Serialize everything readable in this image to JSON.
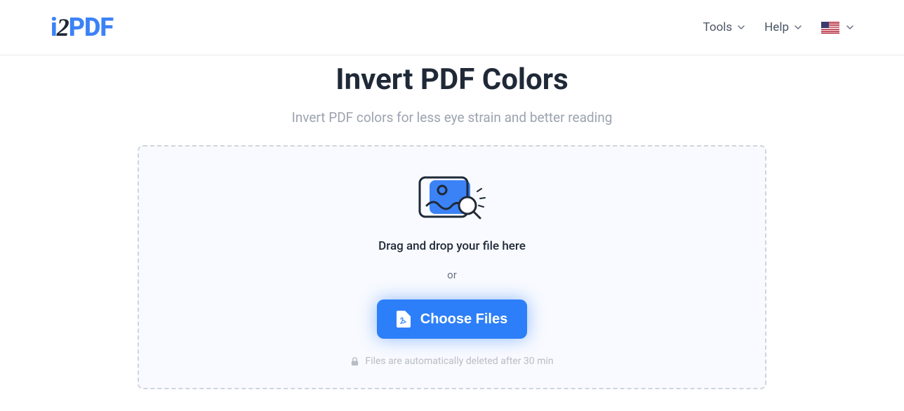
{
  "logo": {
    "part1": "i",
    "part2": "2",
    "part3": "PDF"
  },
  "nav": {
    "tools": "Tools",
    "help": "Help"
  },
  "page": {
    "title": "Invert PDF Colors",
    "subtitle": "Invert PDF colors for less eye strain and better reading"
  },
  "dropzone": {
    "drag_text": "Drag and drop your file here",
    "or_text": "or",
    "button_label": "Choose Files",
    "delete_note": "Files are automatically deleted after 30 min"
  }
}
